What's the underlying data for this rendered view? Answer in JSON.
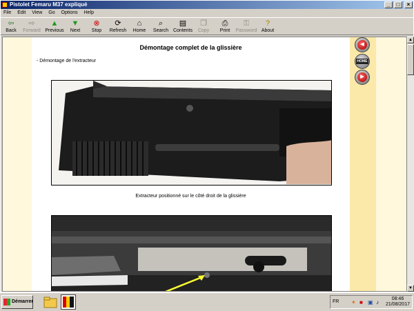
{
  "window": {
    "title": "Pistolet Femaru M37 expliqué"
  },
  "menu": [
    "File",
    "Edit",
    "View",
    "Go",
    "Options",
    "Help"
  ],
  "toolbar": {
    "back": "Back",
    "forward": "Forward",
    "previous": "Previous",
    "next": "Next",
    "stop": "Stop",
    "refresh": "Refresh",
    "home": "Home",
    "search": "Search",
    "contents": "Contents",
    "copy": "Copy",
    "print": "Print",
    "password": "Password",
    "about": "About"
  },
  "page": {
    "title": "Démontage complet de la glissière",
    "section": "- Démontage de l'extracteur",
    "caption1": "Extracteur positionné sur le côté droit de la glissière"
  },
  "nav": {
    "home_label": "HOME"
  },
  "taskbar": {
    "start": "Démarrer",
    "lang": "FR",
    "time": "08:46",
    "date": "21/08/2017"
  },
  "colors": {
    "title_start": "#0a246a",
    "page_bg": "#fff8dc",
    "side_strip": "#fbe9a9",
    "nav_red": "#c00000",
    "arrow_yellow": "#ffff33"
  }
}
